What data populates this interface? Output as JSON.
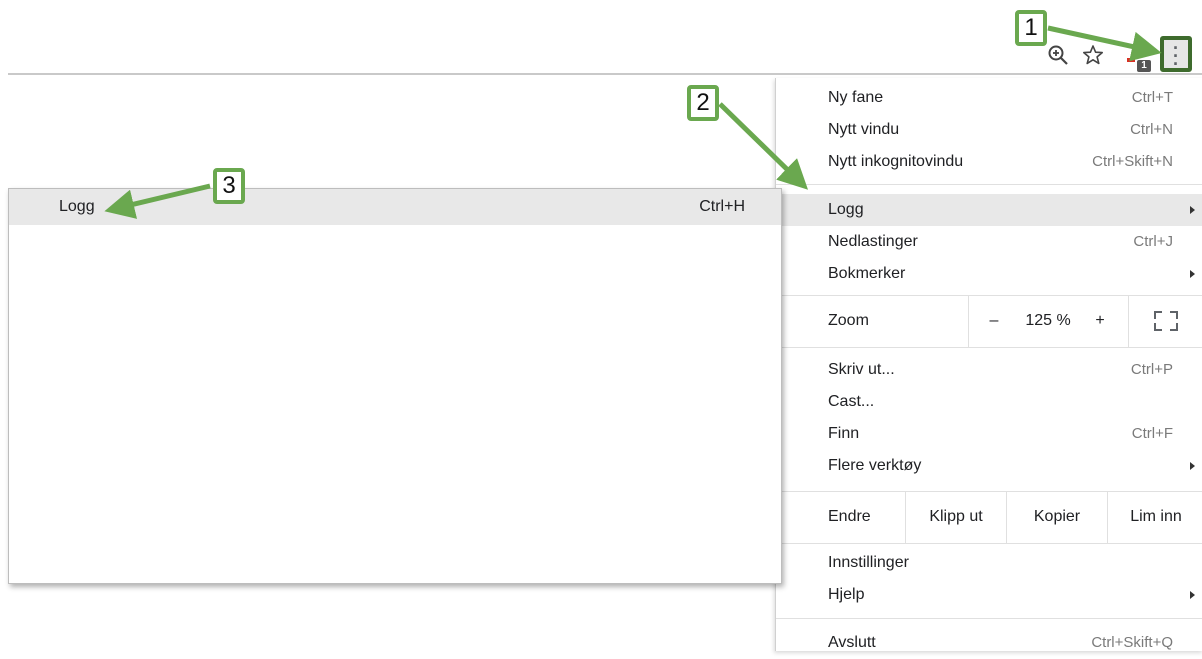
{
  "toolbar": {
    "zoom_icon": "zoom-in-icon",
    "star_icon": "bookmark-star-icon",
    "extension_badge": "1",
    "menu_icon": "more-vert-icon"
  },
  "menu": {
    "items_top": [
      {
        "label": "Ny fane",
        "shortcut": "Ctrl+T"
      },
      {
        "label": "Nytt vindu",
        "shortcut": "Ctrl+N"
      },
      {
        "label": "Nytt inkognitovindu",
        "shortcut": "Ctrl+Skift+N"
      }
    ],
    "history": {
      "label": "Logg"
    },
    "downloads": {
      "label": "Nedlastinger",
      "shortcut": "Ctrl+J"
    },
    "bookmarks": {
      "label": "Bokmerker"
    },
    "zoom": {
      "label": "Zoom",
      "minus": "–",
      "value": "125 %",
      "plus": "+"
    },
    "print": {
      "label": "Skriv ut...",
      "shortcut": "Ctrl+P"
    },
    "cast": {
      "label": "Cast..."
    },
    "find": {
      "label": "Finn",
      "shortcut": "Ctrl+F"
    },
    "more_tools": {
      "label": "Flere verktøy"
    },
    "edit": {
      "label": "Endre",
      "cut": "Klipp ut",
      "copy": "Kopier",
      "paste": "Lim inn"
    },
    "settings": {
      "label": "Innstillinger"
    },
    "help": {
      "label": "Hjelp"
    },
    "exit": {
      "label": "Avslutt",
      "shortcut": "Ctrl+Skift+Q"
    }
  },
  "submenu": {
    "history": {
      "label": "Logg",
      "shortcut": "Ctrl+H"
    }
  },
  "callouts": [
    "1",
    "2",
    "3"
  ],
  "colors": {
    "accent": "#6aa84f",
    "accent_dark": "#3e6b2d",
    "highlight": "#e8e8e8"
  }
}
